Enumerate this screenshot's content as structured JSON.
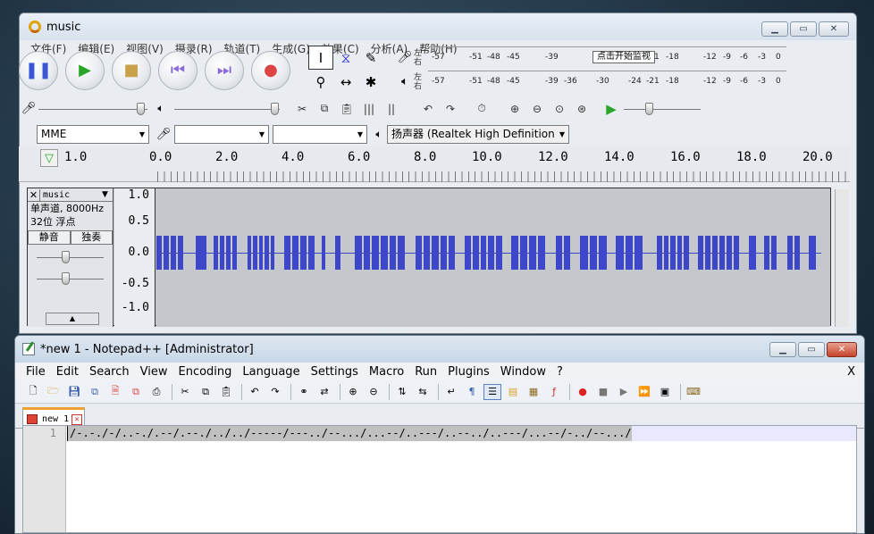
{
  "audacity": {
    "title": "music",
    "menu": [
      "文件(F)",
      "编辑(E)",
      "视图(V)",
      "摄录(R)",
      "轨道(T)",
      "生成(G)",
      "效果(C)",
      "分析(A)",
      "帮助(H)"
    ],
    "meter": {
      "record_lr": "左\n右",
      "play_lr": "左\n右",
      "ticks_top": [
        "-57",
        "-51",
        "-48",
        "-45",
        "-39",
        "-4",
        "-21",
        "-18",
        "-12",
        "-9",
        "-6",
        "-3",
        "0"
      ],
      "ticks_bottom": [
        "-57",
        "-51",
        "-48",
        "-45",
        "-39",
        "-36",
        "-30",
        "-24",
        "-21",
        "-18",
        "-12",
        "-9",
        "-6",
        "-3",
        "0"
      ],
      "monitor_label": "点击开始监视"
    },
    "device": {
      "host": "MME",
      "mic_device": "",
      "channels": "",
      "speaker_device": "扬声器 (Realtek High Definition"
    },
    "ruler_labels": [
      "1.0",
      "0.0",
      "2.0",
      "4.0",
      "6.0",
      "8.0",
      "10.0",
      "12.0",
      "14.0",
      "16.0",
      "18.0",
      "20.0"
    ],
    "track": {
      "name": "music",
      "info_line1": "单声道, 8000Hz",
      "info_line2": "32位 浮点",
      "mute": "静音",
      "solo": "独奏",
      "scale": [
        "1.0",
        "0.5",
        "0.0",
        "-0.5",
        "-1.0"
      ]
    }
  },
  "notepad": {
    "title": "*new 1 - Notepad++ [Administrator]",
    "menu": [
      "File",
      "Edit",
      "Search",
      "View",
      "Encoding",
      "Language",
      "Settings",
      "Macro",
      "Run",
      "Plugins",
      "Window",
      "?"
    ],
    "menu_close": "X",
    "tab_label": "new 1",
    "line_number": "1",
    "line_text": "/-.-./-/..-./.--/.--./../../-----/---../--.../...--/..---/..--../..---/...--/-../--.../"
  },
  "window_buttons": {
    "minimize": "▁",
    "maximize": "▭",
    "close": "✕"
  }
}
